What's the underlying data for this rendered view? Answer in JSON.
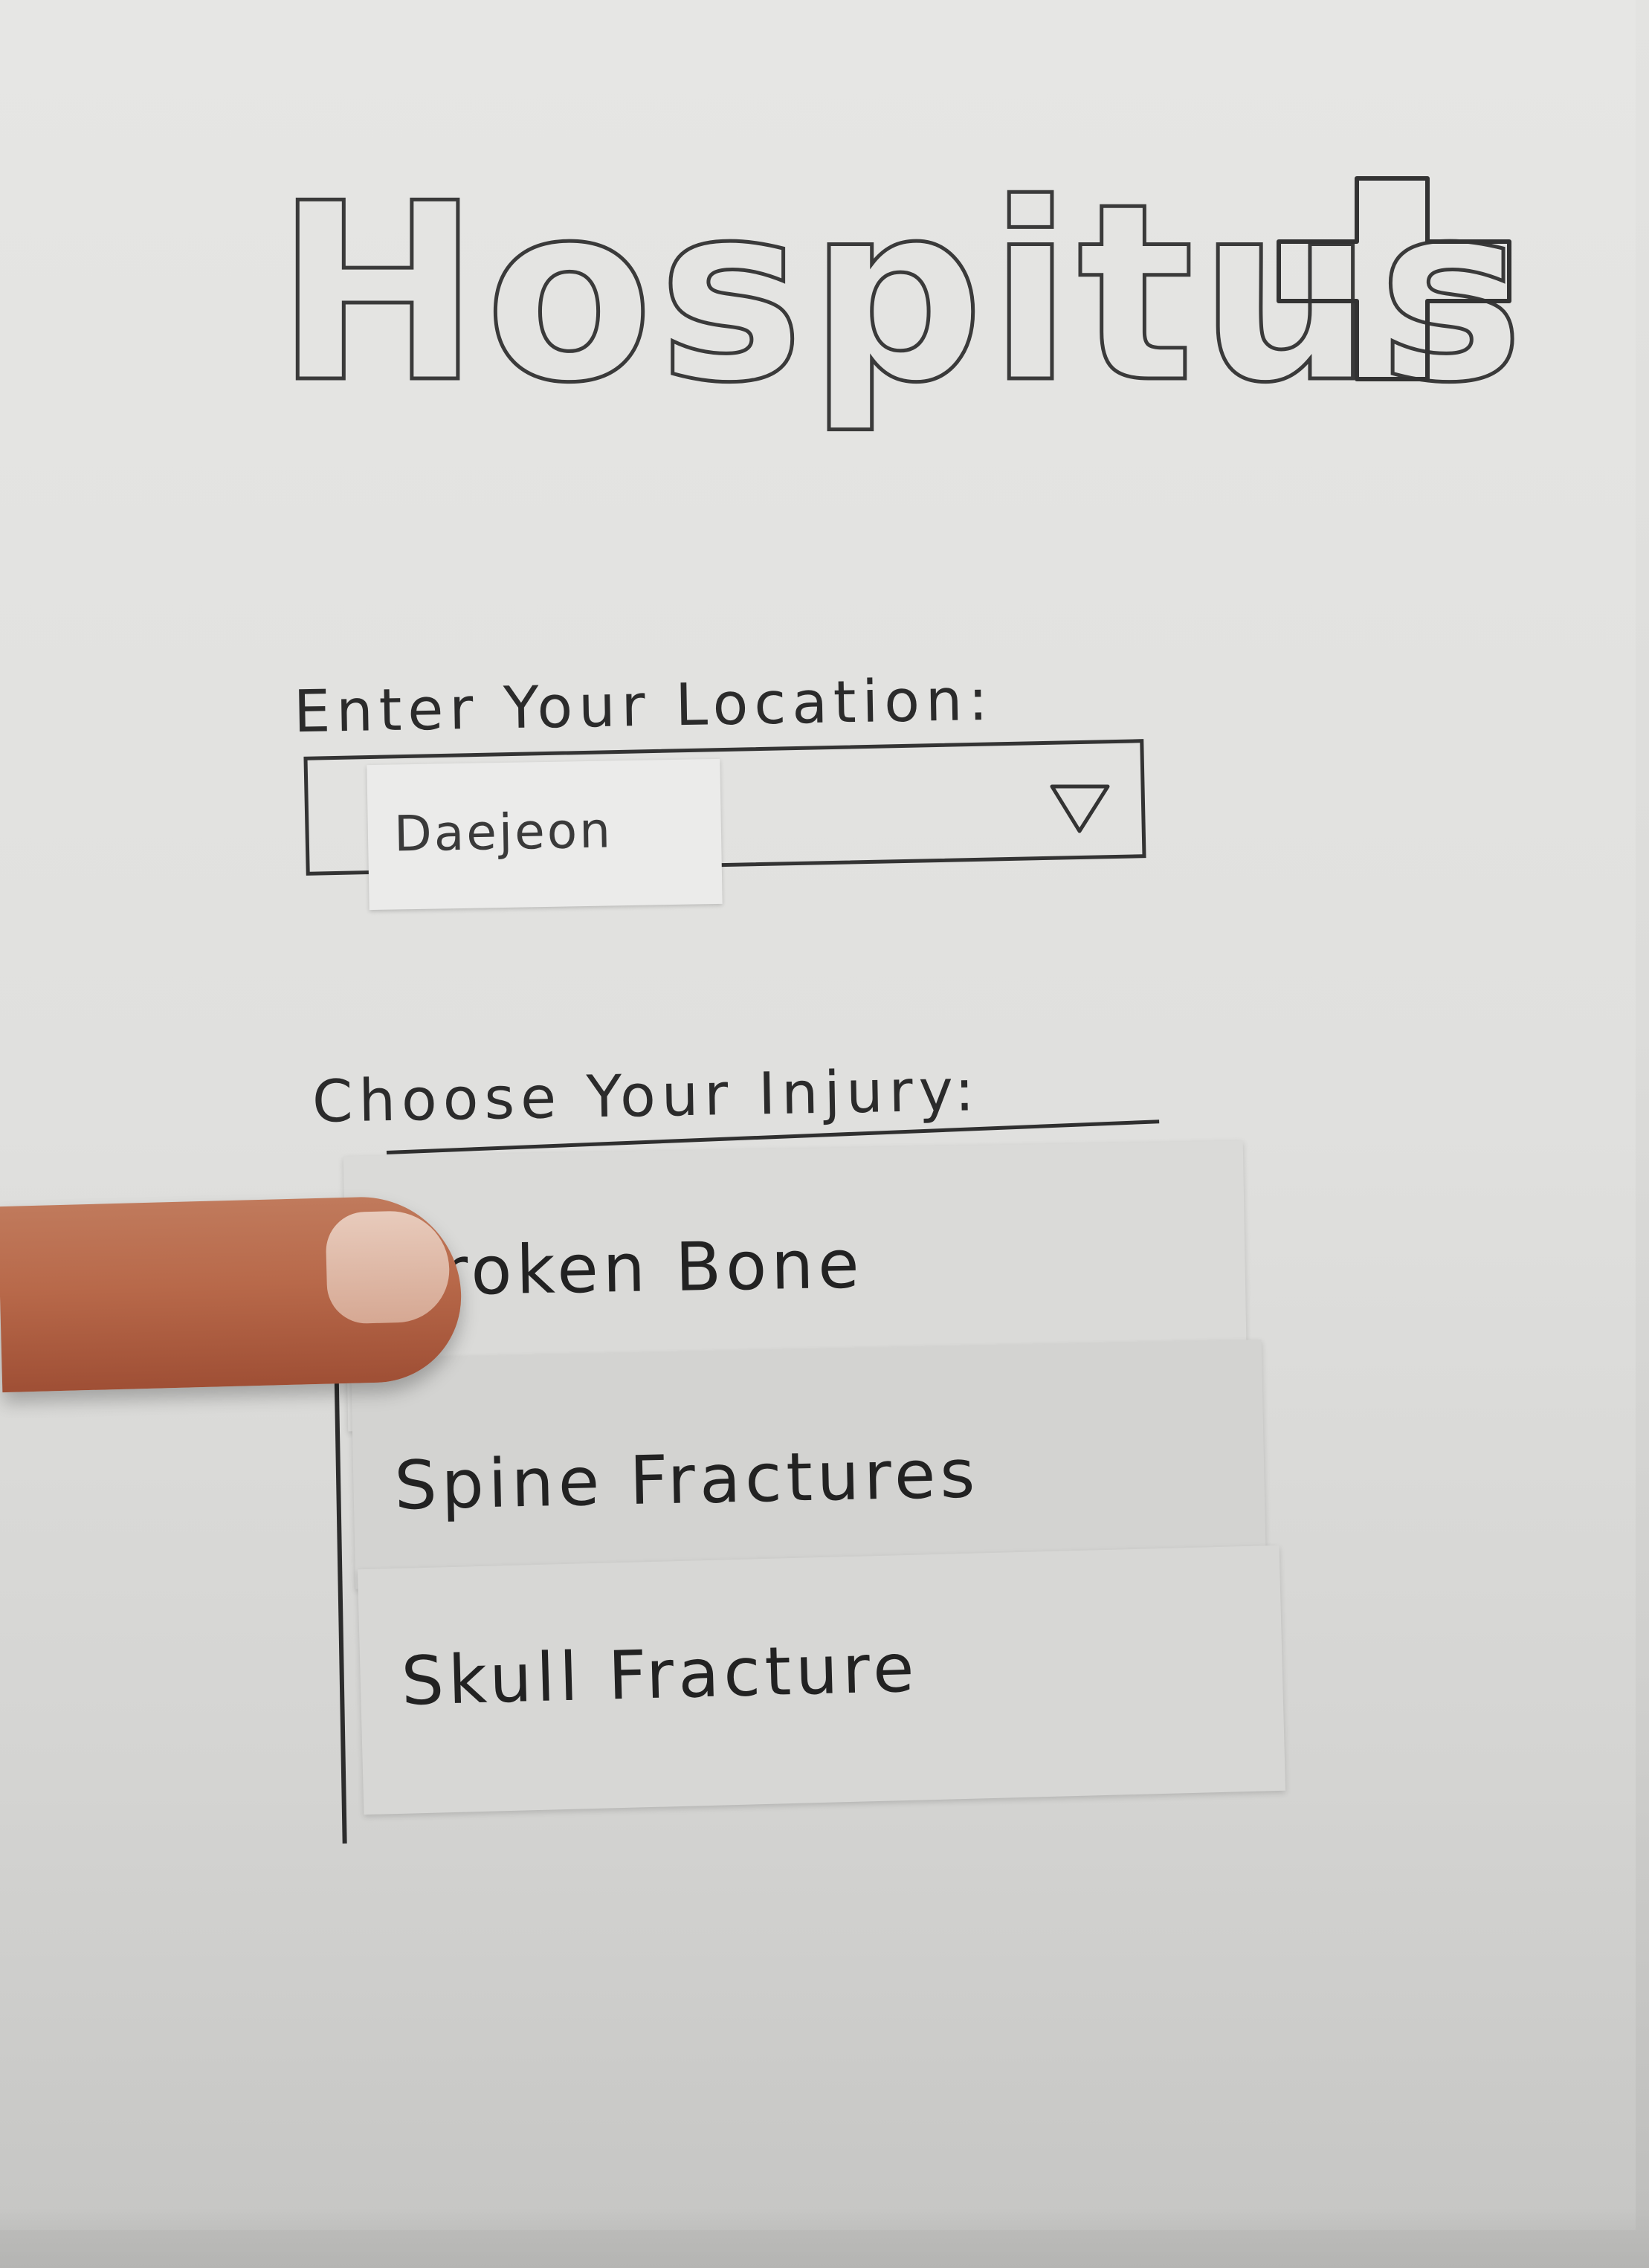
{
  "app": {
    "title": "Hospitus"
  },
  "location": {
    "label": "Enter Your Location:",
    "value": "Daejeon"
  },
  "injury": {
    "label": "Choose Your Injury:",
    "options": [
      {
        "label": "Broken Bone"
      },
      {
        "label": "Spine Fractures"
      },
      {
        "label": "Skull Fracture"
      }
    ]
  },
  "icons": {
    "logo": "plus-cross-icon",
    "dropdown": "triangle-down-icon"
  },
  "colors": {
    "ink": "#2b2b2b",
    "paper": "#e3e3e1"
  }
}
